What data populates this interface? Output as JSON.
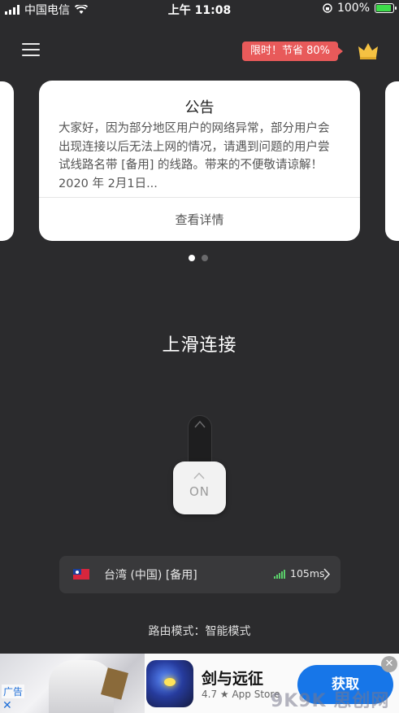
{
  "status_bar": {
    "carrier": "中国电信",
    "time": "上午 11:08",
    "battery_text": "100%",
    "battery_level": 1.0
  },
  "header": {
    "promo_badge": "限时！节省 80%",
    "crown_icon": "crown-icon",
    "menu_icon": "hamburger-menu-icon"
  },
  "announcement": {
    "title": "公告",
    "body": "大家好，因为部分地区用户的网络异常，部分用户会出现连接以后无法上网的情况，请遇到问题的用户尝试线路名带 [备用] 的线路。带来的不便敬请谅解！2020 年 2月1日...",
    "link": "查看详情",
    "page_count": 2,
    "active_page": 0
  },
  "connect": {
    "slide_label": "上滑连接",
    "knob_label": "ON"
  },
  "server": {
    "flag_icon": "taiwan-flag-icon",
    "name": "台湾 (中国) [备用]",
    "latency": "105ms",
    "signal_color": "#5bd06b"
  },
  "route_mode": "路由模式：智能模式",
  "ad": {
    "label": "广告",
    "app_name": "剑与远征",
    "rating": "4.7 ★ App Store",
    "cta": "获取",
    "watermark": "9K9K 思创网"
  },
  "colors": {
    "background": "#2b2b2d",
    "promo": "#e85a5a",
    "cta": "#1776e8"
  }
}
